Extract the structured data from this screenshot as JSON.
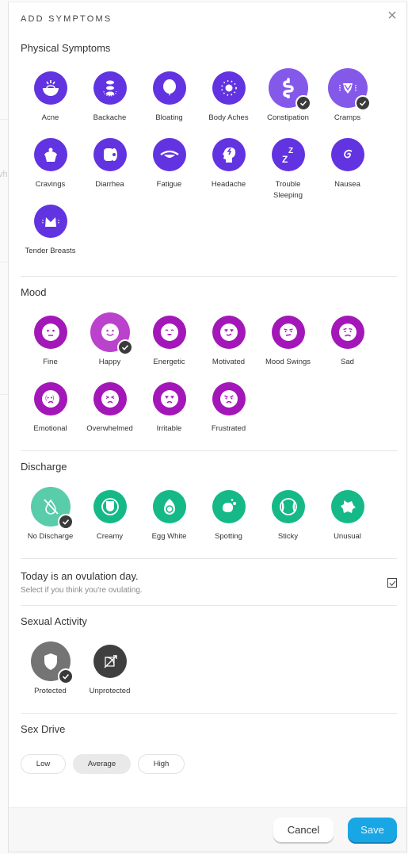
{
  "modal": {
    "title": "ADD SYMPTOMS",
    "close_icon": "close-icon"
  },
  "background": {
    "partial_text": "vh"
  },
  "colors": {
    "physical": "#6233e0",
    "physical_selected": "#8459ea",
    "mood": "#a317b9",
    "mood_selected": "#bb42cc",
    "discharge": "#14b987",
    "discharge_selected": "#59cca9",
    "sexual": "#3f3f3f",
    "sexual_selected": "#747474",
    "save_button": "#19a6e5",
    "check_badge": "#3a3a3a"
  },
  "physical": {
    "title": "Physical Symptoms",
    "items": [
      {
        "label": "Acne",
        "icon": "acne-icon",
        "selected": false
      },
      {
        "label": "Backache",
        "icon": "backache-icon",
        "selected": false
      },
      {
        "label": "Bloating",
        "icon": "bloating-icon",
        "selected": false
      },
      {
        "label": "Body Aches",
        "icon": "body-aches-icon",
        "selected": false
      },
      {
        "label": "Constipation",
        "icon": "constipation-icon",
        "selected": true
      },
      {
        "label": "Cramps",
        "icon": "cramps-icon",
        "selected": true
      },
      {
        "label": "Cravings",
        "icon": "cravings-icon",
        "selected": false
      },
      {
        "label": "Diarrhea",
        "icon": "diarrhea-icon",
        "selected": false
      },
      {
        "label": "Fatigue",
        "icon": "fatigue-icon",
        "selected": false
      },
      {
        "label": "Headache",
        "icon": "headache-icon",
        "selected": false
      },
      {
        "label": "Trouble Sleeping",
        "icon": "sleep-icon",
        "selected": false
      },
      {
        "label": "Nausea",
        "icon": "nausea-icon",
        "selected": false
      },
      {
        "label": "Tender Breasts",
        "icon": "tender-breasts-icon",
        "selected": false
      }
    ]
  },
  "mood": {
    "title": "Mood",
    "items": [
      {
        "label": "Fine",
        "icon": "fine-face-icon",
        "selected": false
      },
      {
        "label": "Happy",
        "icon": "happy-face-icon",
        "selected": true
      },
      {
        "label": "Energetic",
        "icon": "energetic-face-icon",
        "selected": false
      },
      {
        "label": "Motivated",
        "icon": "motivated-face-icon",
        "selected": false
      },
      {
        "label": "Mood Swings",
        "icon": "mood-swings-face-icon",
        "selected": false
      },
      {
        "label": "Sad",
        "icon": "sad-face-icon",
        "selected": false
      },
      {
        "label": "Emotional",
        "icon": "emotional-face-icon",
        "selected": false
      },
      {
        "label": "Overwhelmed",
        "icon": "overwhelmed-face-icon",
        "selected": false
      },
      {
        "label": "Irritable",
        "icon": "irritable-face-icon",
        "selected": false
      },
      {
        "label": "Frustrated",
        "icon": "frustrated-face-icon",
        "selected": false
      }
    ]
  },
  "discharge": {
    "title": "Discharge",
    "items": [
      {
        "label": "No Discharge",
        "icon": "no-discharge-icon",
        "selected": true
      },
      {
        "label": "Creamy",
        "icon": "creamy-icon",
        "selected": false
      },
      {
        "label": "Egg White",
        "icon": "egg-white-icon",
        "selected": false
      },
      {
        "label": "Spotting",
        "icon": "spotting-icon",
        "selected": false
      },
      {
        "label": "Sticky",
        "icon": "sticky-icon",
        "selected": false
      },
      {
        "label": "Unusual",
        "icon": "unusual-icon",
        "selected": false
      }
    ]
  },
  "ovulation": {
    "title": "Today is an ovulation day.",
    "subtitle": "Select if you think you're ovulating.",
    "checked": true
  },
  "sexual_activity": {
    "title": "Sexual Activity",
    "items": [
      {
        "label": "Protected",
        "icon": "shield-icon",
        "selected": true
      },
      {
        "label": "Unprotected",
        "icon": "unprotected-icon",
        "selected": false
      }
    ]
  },
  "sex_drive": {
    "title": "Sex Drive",
    "options": [
      {
        "label": "Low",
        "active": false
      },
      {
        "label": "Average",
        "active": true
      },
      {
        "label": "High",
        "active": false
      }
    ]
  },
  "footer": {
    "cancel_label": "Cancel",
    "save_label": "Save"
  }
}
